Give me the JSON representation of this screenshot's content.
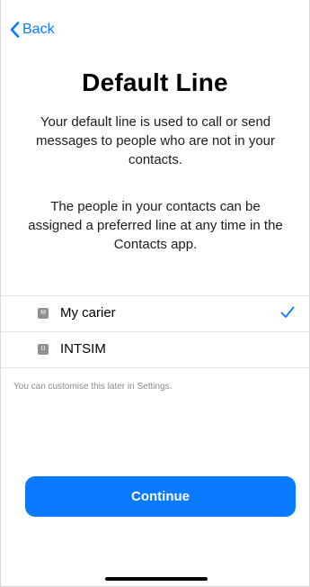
{
  "nav": {
    "back_label": "Back",
    "back_icon": "chevron-left-icon"
  },
  "header": {
    "title": "Default Line"
  },
  "body": {
    "paragraph1": "Your default line is used to call or send messages to people who are not in your contacts.",
    "paragraph2": "The people in your contacts can be assigned a preferred line at any time in the Contacts app."
  },
  "lines": [
    {
      "badge": "M",
      "label": "My carier",
      "selected": true
    },
    {
      "badge": "U",
      "label": "INTSIM",
      "selected": false
    }
  ],
  "footnote": "You can customise this later in Settings.",
  "actions": {
    "continue_label": "Continue"
  },
  "colors": {
    "accent": "#0a7aff",
    "badge": "#8e8e93",
    "footnote": "#8a8a8e"
  }
}
